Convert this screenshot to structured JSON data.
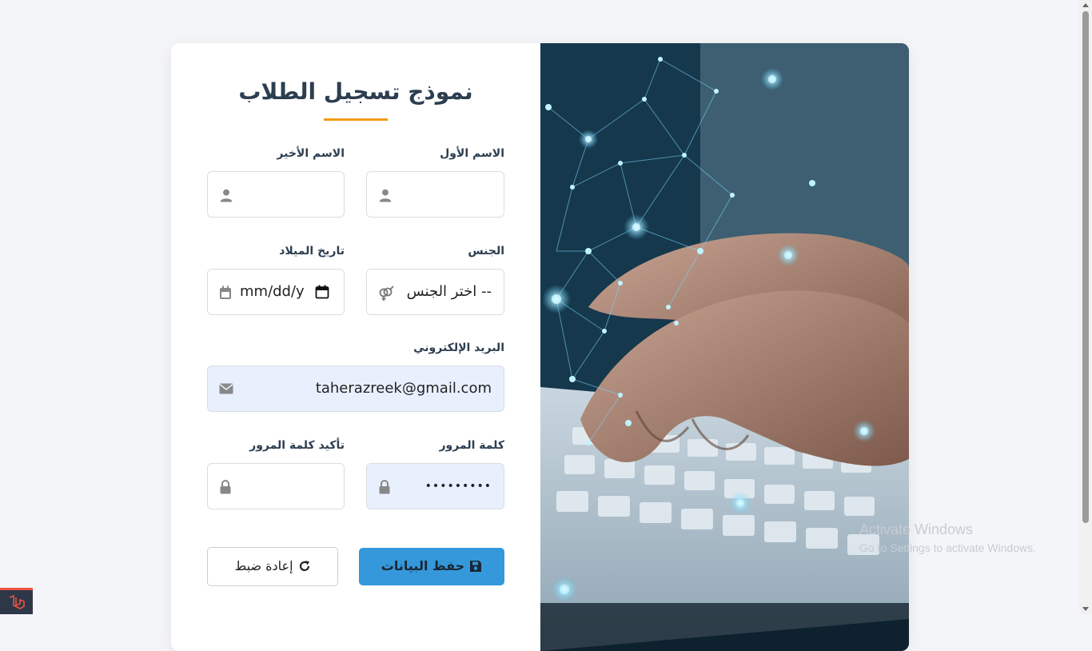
{
  "form": {
    "title": "نموذج تسجيل الطلاب",
    "first_name": {
      "label": "الاسم الأول",
      "value": ""
    },
    "last_name": {
      "label": "الاسم الأخير",
      "value": ""
    },
    "gender": {
      "label": "الجنس",
      "selected": "-- اختر الجنس"
    },
    "birth_date": {
      "label": "تاريخ الميلاد",
      "placeholder": "mm/dd/yyyy",
      "visible_text": "mm/dd/y"
    },
    "email": {
      "label": "البريد الإلكتروني",
      "value": "taherazreek@gmail.com"
    },
    "password": {
      "label": "كلمة المرور",
      "value": "•••••••••"
    },
    "confirm_password": {
      "label": "تأكيد كلمة المرور",
      "value": ""
    },
    "save_label": "حفظ البيانات",
    "reset_label": "إعادة ضبط"
  },
  "watermark": {
    "line1": "Activate Windows",
    "line2": "Go to Settings to activate Windows."
  },
  "icons": [
    "user-icon",
    "venus-mars-icon",
    "calendar-icon",
    "envelope-icon",
    "lock-icon",
    "save-icon",
    "redo-icon",
    "laravel-icon"
  ],
  "colors": {
    "accent": "#3498db",
    "underline": "#f39c12",
    "title": "#2c3e50",
    "autofill": "#e8f0fe"
  }
}
